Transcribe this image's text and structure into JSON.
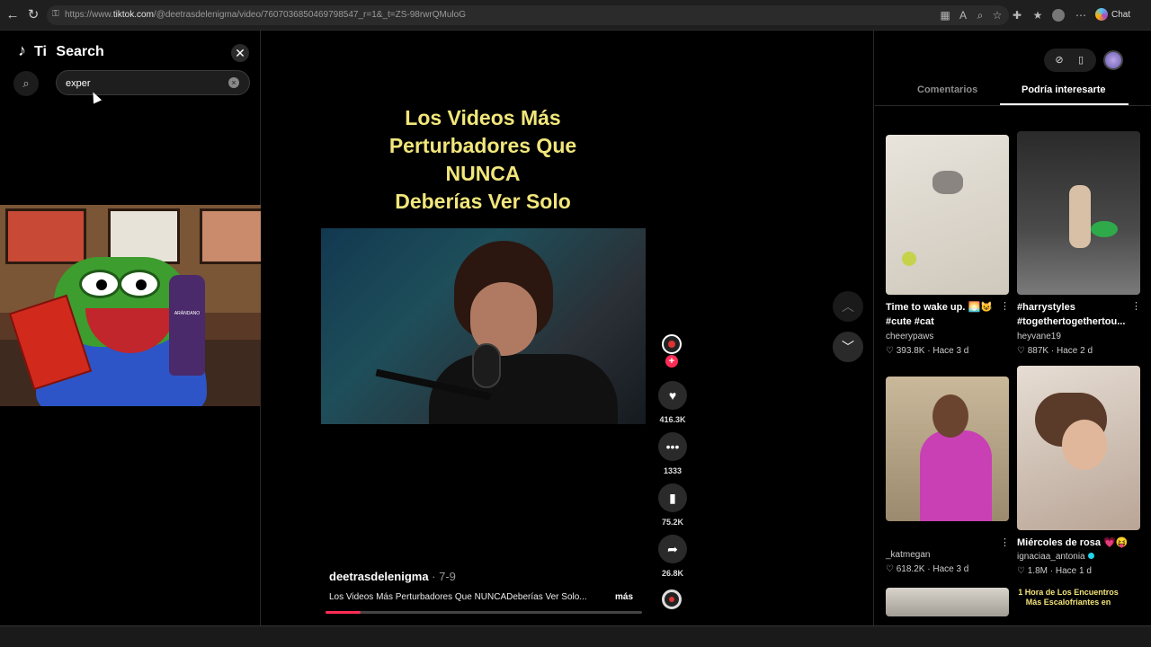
{
  "browser": {
    "url_prefix": "https://www.",
    "url_host": "tiktok.com",
    "url_rest": "/@deetrasdelenigma/video/7607036850469798547_r=1&_t=ZS-98rwrQMuloG",
    "chat_label": "Chat"
  },
  "search_panel": {
    "brand": "Ti",
    "title": "Search",
    "query": "exper"
  },
  "video": {
    "title_lines": [
      "Los Videos Más",
      "Perturbadores Que",
      "NUNCA",
      "Deberías Ver Solo"
    ],
    "author": "deetrasdelenigma",
    "date": " · 7-9",
    "description": "Los Videos Más Perturbadores Que NUNCADeberías Ver Solo...",
    "more_label": "más",
    "progress": 0.11,
    "likes": "416.3K",
    "comments": "1333",
    "saves": "75.2K",
    "shares": "26.8K",
    "overlay_bottle_label": "ARÁNDANO"
  },
  "right_panel": {
    "tabs": [
      "Comentarios",
      "Podría interesarte"
    ],
    "active_tab": "Podría interesarte",
    "cards": [
      {
        "title": "Time to wake up. 🌅😺 #cute #cat",
        "user": "cheerypaws",
        "likes": "393.8K",
        "age": "Hace 3 d"
      },
      {
        "title": "#harrystyles #togethertogethertou...",
        "user": "heyvane19",
        "likes": "887K",
        "age": "Hace 2 d"
      },
      {
        "title": "",
        "user": "_katmegan",
        "likes": "618.2K",
        "age": "Hace 3 d"
      },
      {
        "title": "Miércoles de rosa 💗😝",
        "user": "ignaciaa_antonia",
        "likes": "1.8M",
        "age": "Hace 1 d"
      }
    ],
    "promo_text": "1 Hora de Los Encuentros Más Escalofriantes en"
  },
  "colors": {
    "accent": "#fe2c55",
    "title_yellow": "#f1e67a"
  }
}
